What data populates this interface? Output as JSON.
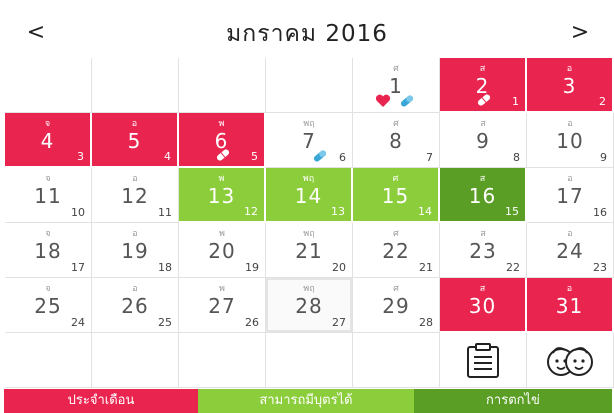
{
  "header": {
    "title": "มกราคม 2016",
    "prev_glyph": "<",
    "next_glyph": ">"
  },
  "colors": {
    "period": "#e8244f",
    "fertile": "#8ccd3c",
    "ovulation": "#5a9e25"
  },
  "calendar": {
    "rows": [
      [
        {
          "dow": "",
          "day": "",
          "sub": "",
          "state": "empty"
        },
        {
          "dow": "",
          "day": "",
          "sub": "",
          "state": "empty"
        },
        {
          "dow": "",
          "day": "",
          "sub": "",
          "state": "empty"
        },
        {
          "dow": "",
          "day": "",
          "sub": "",
          "state": "empty"
        },
        {
          "dow": "ศ",
          "day": "1",
          "sub": "",
          "state": "normal",
          "icons": [
            "heart-icon",
            "pill-blue-icon"
          ]
        },
        {
          "dow": "ส",
          "day": "2",
          "sub": "1",
          "state": "period",
          "icons": [
            "pill-icon"
          ]
        },
        {
          "dow": "อ",
          "day": "3",
          "sub": "2",
          "state": "period"
        }
      ],
      [
        {
          "dow": "จ",
          "day": "4",
          "sub": "3",
          "state": "period"
        },
        {
          "dow": "อ",
          "day": "5",
          "sub": "4",
          "state": "period"
        },
        {
          "dow": "พ",
          "day": "6",
          "sub": "5",
          "state": "period",
          "icons": [
            "pill-icon"
          ]
        },
        {
          "dow": "พฤ",
          "day": "7",
          "sub": "6",
          "state": "normal",
          "icons": [
            "pill-blue-icon"
          ]
        },
        {
          "dow": "ศ",
          "day": "8",
          "sub": "7",
          "state": "normal"
        },
        {
          "dow": "ส",
          "day": "9",
          "sub": "8",
          "state": "normal"
        },
        {
          "dow": "อ",
          "day": "10",
          "sub": "9",
          "state": "normal"
        }
      ],
      [
        {
          "dow": "จ",
          "day": "11",
          "sub": "10",
          "state": "normal"
        },
        {
          "dow": "อ",
          "day": "12",
          "sub": "11",
          "state": "normal"
        },
        {
          "dow": "พ",
          "day": "13",
          "sub": "12",
          "state": "fertile"
        },
        {
          "dow": "พฤ",
          "day": "14",
          "sub": "13",
          "state": "fertile"
        },
        {
          "dow": "ศ",
          "day": "15",
          "sub": "14",
          "state": "fertile"
        },
        {
          "dow": "ส",
          "day": "16",
          "sub": "15",
          "state": "ovulation"
        },
        {
          "dow": "อ",
          "day": "17",
          "sub": "16",
          "state": "normal"
        }
      ],
      [
        {
          "dow": "จ",
          "day": "18",
          "sub": "17",
          "state": "normal"
        },
        {
          "dow": "อ",
          "day": "19",
          "sub": "18",
          "state": "normal"
        },
        {
          "dow": "พ",
          "day": "20",
          "sub": "19",
          "state": "normal"
        },
        {
          "dow": "พฤ",
          "day": "21",
          "sub": "20",
          "state": "normal"
        },
        {
          "dow": "ศ",
          "day": "22",
          "sub": "21",
          "state": "normal"
        },
        {
          "dow": "ส",
          "day": "23",
          "sub": "22",
          "state": "normal"
        },
        {
          "dow": "อ",
          "day": "24",
          "sub": "23",
          "state": "normal"
        }
      ],
      [
        {
          "dow": "จ",
          "day": "25",
          "sub": "24",
          "state": "normal"
        },
        {
          "dow": "อ",
          "day": "26",
          "sub": "25",
          "state": "normal"
        },
        {
          "dow": "พ",
          "day": "27",
          "sub": "26",
          "state": "normal"
        },
        {
          "dow": "พฤ",
          "day": "28",
          "sub": "27",
          "state": "today"
        },
        {
          "dow": "ศ",
          "day": "29",
          "sub": "28",
          "state": "normal"
        },
        {
          "dow": "ส",
          "day": "30",
          "sub": "",
          "state": "period"
        },
        {
          "dow": "อ",
          "day": "31",
          "sub": "",
          "state": "period"
        }
      ],
      [
        {
          "dow": "",
          "day": "",
          "sub": "",
          "state": "empty"
        },
        {
          "dow": "",
          "day": "",
          "sub": "",
          "state": "empty"
        },
        {
          "dow": "",
          "day": "",
          "sub": "",
          "state": "empty"
        },
        {
          "dow": "",
          "day": "",
          "sub": "",
          "state": "empty"
        },
        {
          "dow": "",
          "day": "",
          "sub": "",
          "state": "empty"
        },
        {
          "dow": "",
          "day": "",
          "sub": "",
          "state": "tool",
          "icons": [
            "notes-clipboard-icon"
          ]
        },
        {
          "dow": "",
          "day": "",
          "sub": "",
          "state": "tool",
          "icons": [
            "baby-faces-icon"
          ]
        }
      ]
    ]
  },
  "legend": {
    "period_label": "ประจำเดือน",
    "fertile_label": "สามารถมีบุตรได้",
    "ovulation_label": "การตกไข่"
  }
}
